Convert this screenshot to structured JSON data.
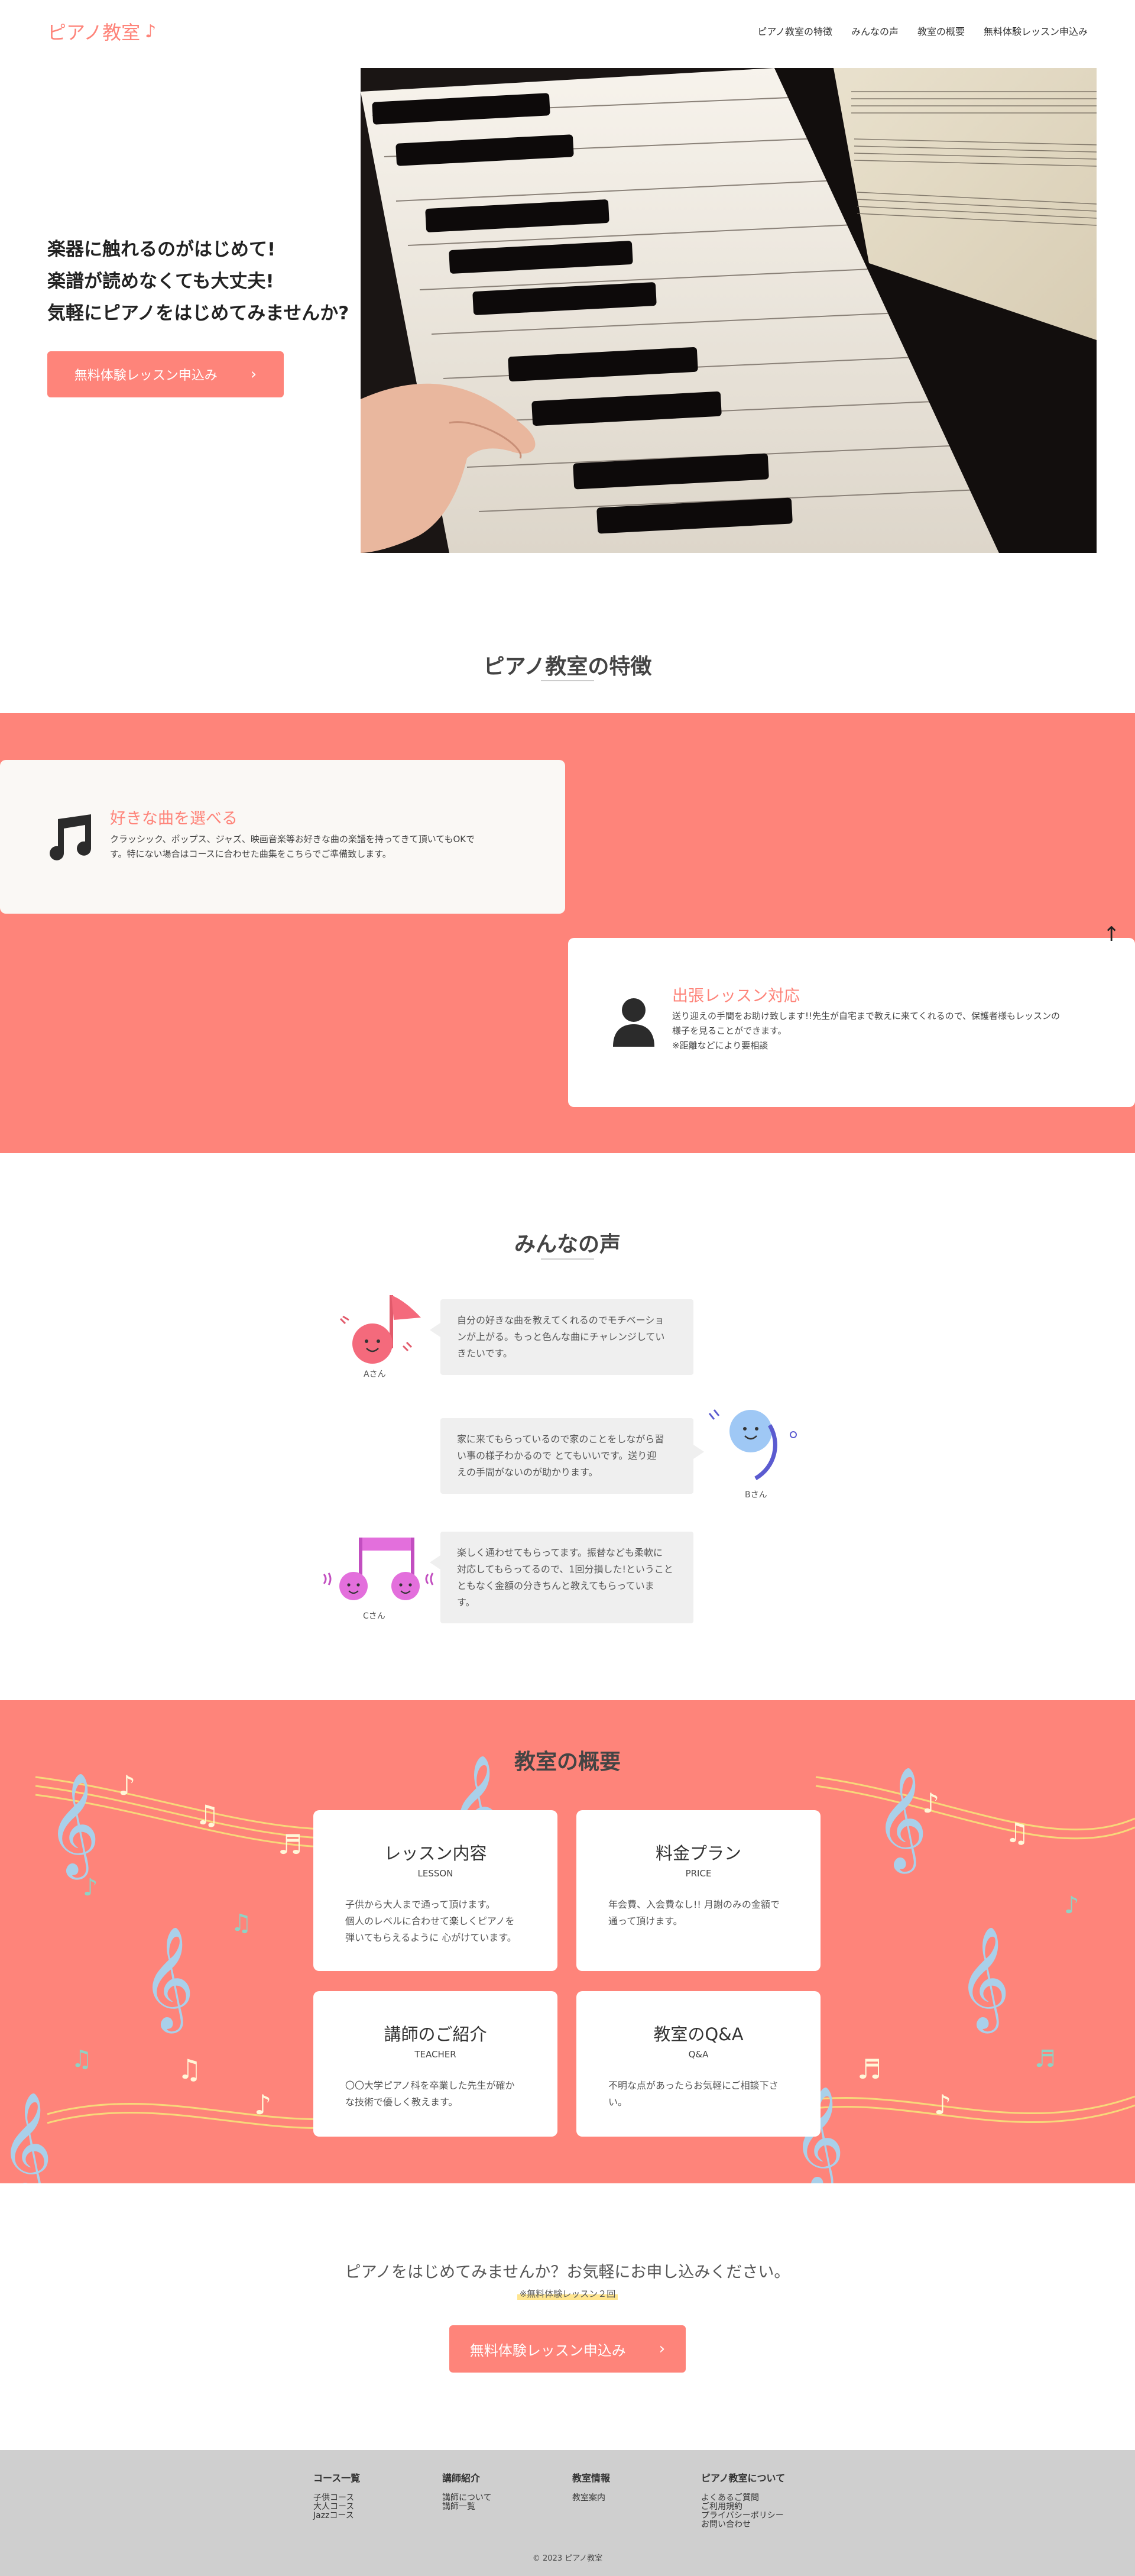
{
  "header": {
    "logo_text": "ピアノ教室",
    "logo_icon": "music-note-icon",
    "nav": [
      "ピアノ教室の特徴",
      "みんなの声",
      "教室の概要",
      "無料体験レッスン申込み"
    ]
  },
  "hero": {
    "lines": [
      "楽器に触れるのがはじめて!",
      "楽譜が読めなくても大丈夫!",
      "気軽にピアノをはじめてみませんか?"
    ],
    "button": "無料体験レッスン申込み",
    "image_alt": "piano-keys-photo"
  },
  "features": {
    "title": "ピアノ教室の特徴",
    "items": [
      {
        "icon": "music-note-icon",
        "title": "好きな曲を選べる",
        "desc_lines": [
          "クラッシック、ポップス、ジャズ、映画音楽等お好きな曲の楽譜を持ってきて頂いてもOKで",
          "す。特にない場合はコースに合わせた曲集をこちらでご準備致します。"
        ]
      },
      {
        "icon": "person-icon",
        "title": "出張レッスン対応",
        "desc_lines": [
          "送り迎えの手間をお助け致します!!先生が自宅まで教えに来てくれるので、保護者様もレッスンの",
          "様子を見ることができます。",
          "※距離などにより要相談"
        ]
      }
    ]
  },
  "voices": {
    "title": "みんなの声",
    "items": [
      {
        "name": "Aさん",
        "lines": [
          "自分の好きな曲を教えてくれるのでモチベーショ",
          "ンが上がる。もっと色んな曲にチャレンジしてい",
          "きたいです。"
        ]
      },
      {
        "name": "Bさん",
        "lines": [
          "家に来てもらっているので家のことをしながら習",
          "い事の様子わかるので とてもいいです。送り迎",
          "えの手間がないのが助かります。"
        ]
      },
      {
        "name": "Cさん",
        "lines": [
          "楽しく通わせてもらってます。振替なども柔軟に",
          "対応してもらってるので、1回分損した!ということ",
          "ともなく金額の分きちんと教えてもらっていま",
          "す。"
        ]
      }
    ]
  },
  "overview": {
    "title": "教室の概要",
    "cards": [
      {
        "title": "レッスン内容",
        "en": "LESSON",
        "lines": [
          "子供から大人まで通って頂けます。",
          "個人のレベルに合わせて楽しくピアノを",
          "弾いてもらえるように 心がけています。"
        ]
      },
      {
        "title": "料金プラン",
        "en": "PRICE",
        "lines": [
          "年会費、入会費なし!! 月謝のみの金額で",
          "通って頂けます。"
        ]
      },
      {
        "title": "講師のご紹介",
        "en": "TEACHER",
        "lines": [
          "〇〇大学ピアノ科を卒業した先生が確か",
          "な技術で優しく教えます。"
        ]
      },
      {
        "title": "教室のQ&A",
        "en": "Q&A",
        "lines": [
          "不明な点があったらお気軽にご相談下さ",
          "い。"
        ]
      }
    ]
  },
  "cta": {
    "text": "ピアノをはじめてみませんか？お気軽にお申し込みください。",
    "note": "※無料体験レッスン２回",
    "button": "無料体験レッスン申込み"
  },
  "footer": {
    "cols": [
      {
        "heading": "コース一覧",
        "links": [
          "子供コース",
          "大人コース",
          "Jazzコース"
        ]
      },
      {
        "heading": "講師紹介",
        "links": [
          "講師について",
          "講師一覧"
        ]
      },
      {
        "heading": "教室情報",
        "links": [
          "教室案内"
        ]
      },
      {
        "heading": "ピアノ教室について",
        "links": [
          "よくあるご質問",
          "ご利用規約",
          "プライバシーポリシー",
          "お問い合わせ"
        ]
      }
    ],
    "copyright": "© 2023 ピアノ教室"
  },
  "colors": {
    "accent": "#fe847a",
    "footer_bg": "#cfcfcf",
    "bubble_bg": "#efefef",
    "highlight": "#ffe58f"
  }
}
